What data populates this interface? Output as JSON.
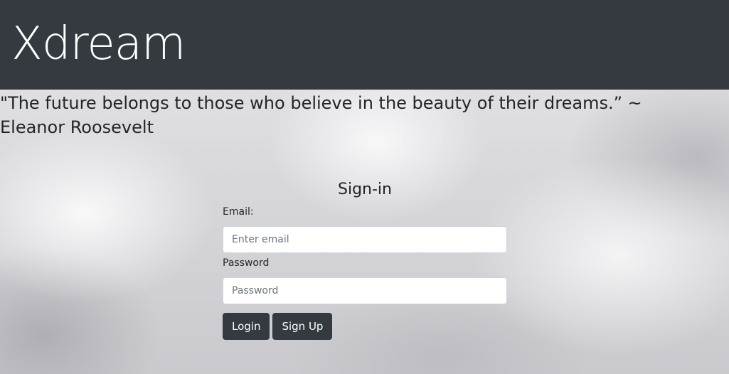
{
  "header": {
    "brand": "Xdream"
  },
  "quote": {
    "text": "\"The future belongs to those who believe in the beauty of their dreams.” ~ Eleanor Roosevelt"
  },
  "signin": {
    "title": "Sign-in",
    "email_label": "Email:",
    "email_placeholder": "Enter email",
    "password_label": "Password",
    "password_placeholder": "Password",
    "login_label": "Login",
    "signup_label": "Sign Up"
  },
  "colors": {
    "navbar": "#343a40",
    "button": "#343a40",
    "text": "#212529"
  }
}
